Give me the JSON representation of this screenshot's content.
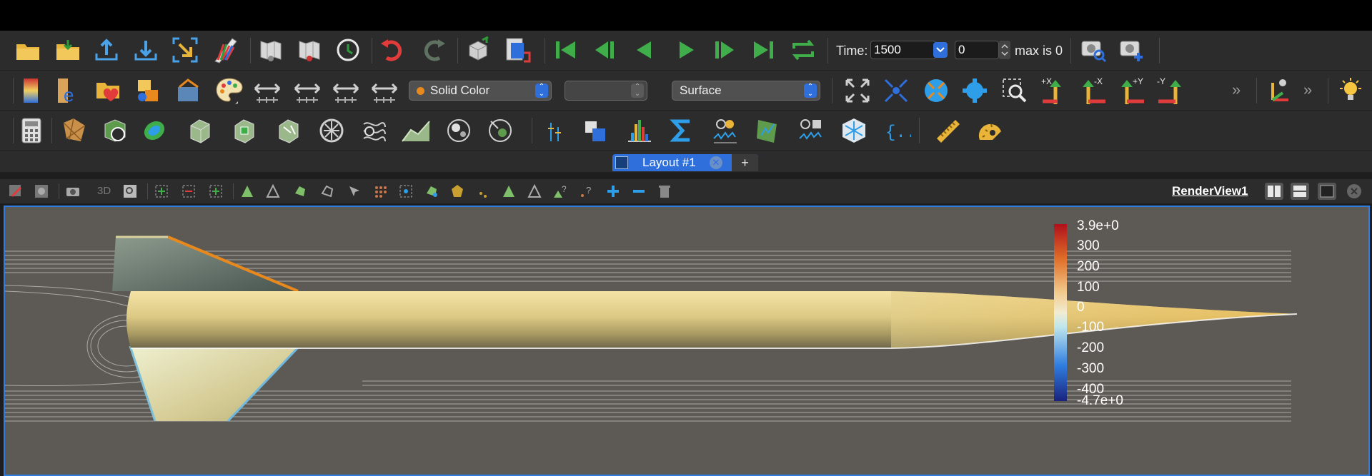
{
  "animation": {
    "time_label": "Time:",
    "time_value": "1500",
    "timestep_value": "0",
    "max_label": "max is 0"
  },
  "display": {
    "coloring": "Solid Color",
    "component": "",
    "representation": "Surface"
  },
  "layout": {
    "tab_label": "Layout #1",
    "add_tab": "+"
  },
  "view": {
    "name": "RenderView1",
    "mode_3d": "3D"
  },
  "camera_labels": {
    "plus_x": "+X",
    "minus_x": "-X",
    "plus_y": "+Y",
    "minus_y": "-Y"
  },
  "overflow": "»",
  "color_legend": {
    "max_label": "3.9e+0",
    "min_label": "-4.7e+0",
    "ticks": [
      "300",
      "200",
      "100",
      "0",
      "-100",
      "-200",
      "-300",
      "-400"
    ]
  },
  "colors": {
    "accent": "#2f6fdc",
    "toolbar_bg": "#2c2c2c",
    "viewport_bg": "#5d5a55",
    "solid_color_dot": "#e8891e"
  }
}
